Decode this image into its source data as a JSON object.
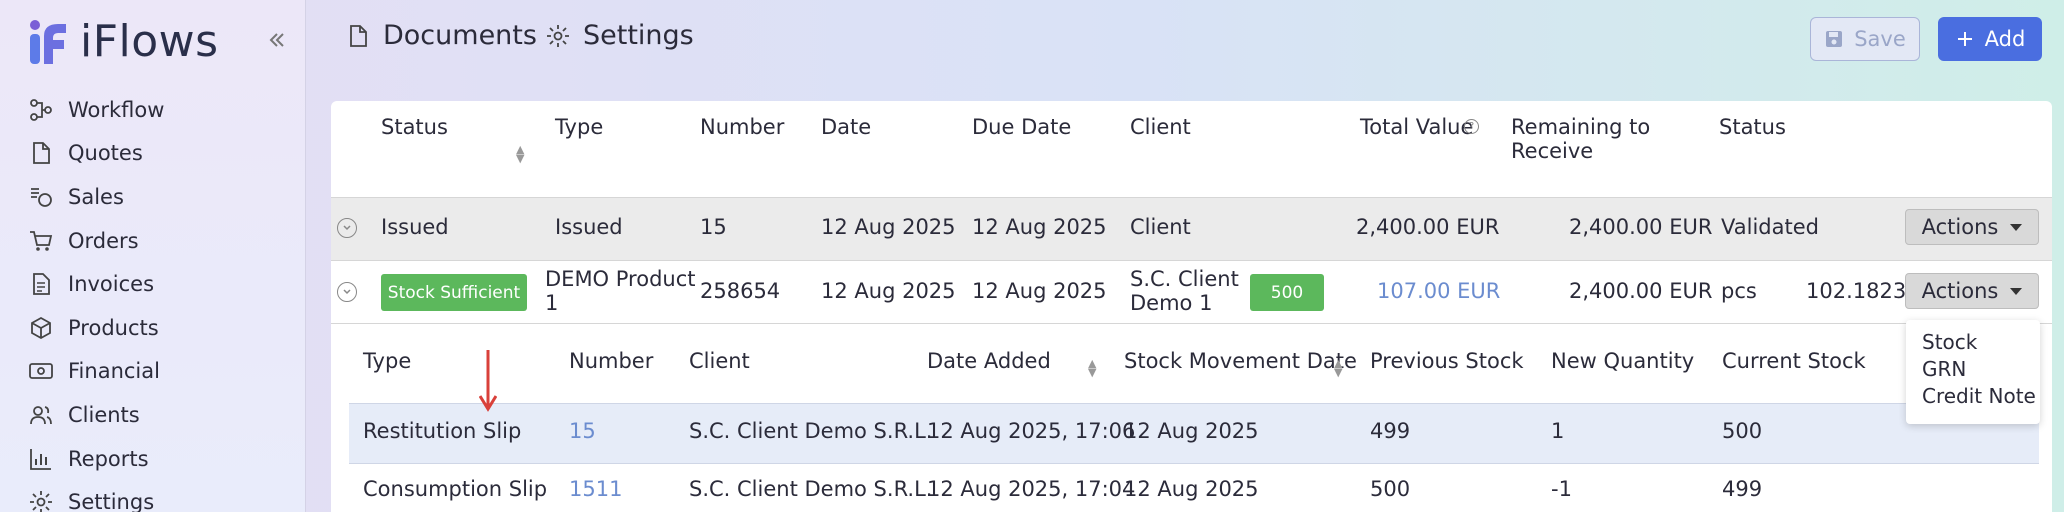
{
  "app": {
    "name": "iFlows"
  },
  "sidebar": {
    "collapse_icon": "double-chevron-left-icon",
    "items": [
      {
        "label": "Workflow",
        "icon": "workflow-icon"
      },
      {
        "label": "Quotes",
        "icon": "document-icon"
      },
      {
        "label": "Sales",
        "icon": "coins-icon"
      },
      {
        "label": "Orders",
        "icon": "cart-icon"
      },
      {
        "label": "Invoices",
        "icon": "invoice-icon"
      },
      {
        "label": "Products",
        "icon": "box-icon"
      },
      {
        "label": "Financial",
        "icon": "banknote-icon"
      },
      {
        "label": "Clients",
        "icon": "users-icon"
      },
      {
        "label": "Reports",
        "icon": "bar-chart-icon"
      },
      {
        "label": "Settings",
        "icon": "gear-icon"
      }
    ]
  },
  "topbar": {
    "tabs": [
      {
        "label": "Documents",
        "icon": "document-icon"
      },
      {
        "label": "Settings",
        "icon": "gear-icon"
      }
    ],
    "save_label": "Save",
    "add_label": "Add"
  },
  "table": {
    "headers": {
      "status": "Status",
      "type": "Type",
      "number": "Number",
      "date": "Date",
      "due_date": "Due Date",
      "client": "Client",
      "total_value": "Total Value",
      "remaining_line1": "Remaining to",
      "remaining_line2": "Receive",
      "status2": "Status"
    },
    "row1": {
      "status": "Issued",
      "type": "Issued",
      "number": "15",
      "date": "12 Aug 2025",
      "due_date": "12 Aug 2025",
      "client": "Client",
      "total_value": "2,400.00 EUR",
      "remaining": "2,400.00 EUR",
      "status2": "Validated",
      "actions_label": "Actions"
    },
    "row2": {
      "status_badge": "Stock Sufficient",
      "type_line1": "DEMO Product",
      "type_line2": "1",
      "number": "258654",
      "date": "12 Aug 2025",
      "due_date": "12 Aug 2025",
      "client_line1": "S.C. Client",
      "client_line2": "Demo 1",
      "qty_badge": "500",
      "total_value": "107.00 EUR",
      "remaining": "2,400.00 EUR",
      "unit": "pcs",
      "extra_value": "102.1823",
      "actions_label": "Actions"
    },
    "actions_menu": [
      "Stock",
      "GRN",
      "Credit Note"
    ]
  },
  "subtable": {
    "headers": {
      "type": "Type",
      "number": "Number",
      "client": "Client",
      "date_added": "Date Added",
      "stock_movement_date": "Stock Movement Date",
      "previous_stock": "Previous Stock",
      "new_quantity": "New Quantity",
      "current_stock": "Current Stock"
    },
    "rows": [
      {
        "type": "Restitution Slip",
        "number": "15",
        "client": "S.C. Client Demo S.R.L.",
        "date_added": "12 Aug 2025, 17:06",
        "movement_date": "12 Aug 2025",
        "previous": "499",
        "new_qty": "1",
        "current": "500"
      },
      {
        "type": "Consumption Slip",
        "number": "1511",
        "client": "S.C. Client Demo S.R.L.",
        "date_added": "12 Aug 2025, 17:04",
        "movement_date": "12 Aug 2025",
        "previous": "500",
        "new_qty": "-1",
        "current": "499"
      }
    ]
  },
  "colors": {
    "accent": "#4a6ee0",
    "success": "#5cb85c",
    "link": "#6b8ccf",
    "annotation_arrow": "#d9403a"
  }
}
